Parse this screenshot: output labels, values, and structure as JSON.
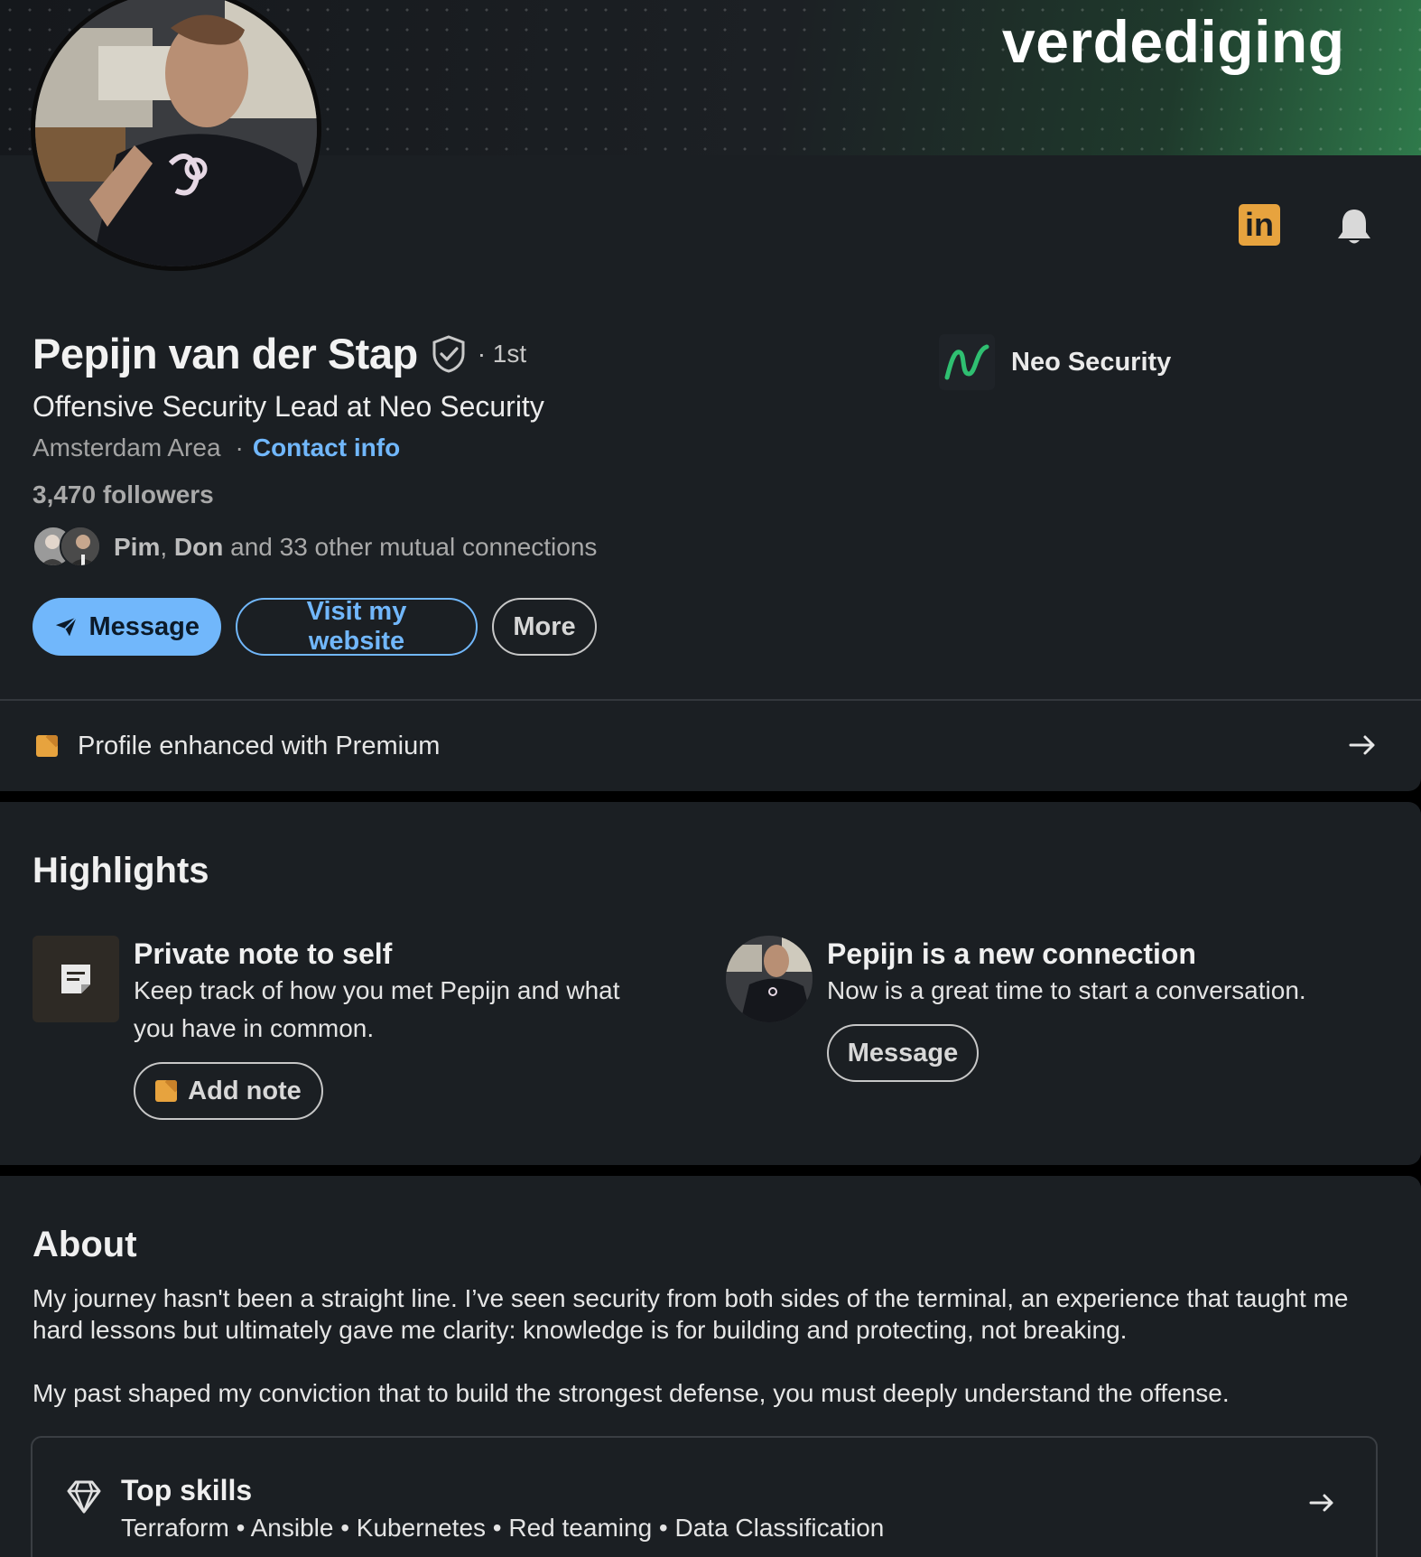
{
  "banner": {
    "word": "verdediging"
  },
  "profile": {
    "name": "Pepijn van der Stap",
    "degree": "· 1st",
    "headline": "Offensive Security Lead at Neo Security",
    "location": "Amsterdam Area",
    "location_separator": "·",
    "contact_label": "Contact info",
    "followers": "3,470 followers",
    "mutual": {
      "name1": "Pim",
      "sep": ", ",
      "name2": "Don",
      "rest": " and 33 other mutual connections"
    },
    "company": "Neo Security",
    "linkedin_badge": "in"
  },
  "actions": {
    "message": "Message",
    "website": "Visit my website",
    "more": "More"
  },
  "premium": {
    "label": "Profile enhanced with Premium"
  },
  "highlights": {
    "title": "Highlights",
    "note": {
      "title": "Private note to self",
      "line1": "Keep track of how you met Pepijn and what",
      "line2": "you have in common.",
      "button": "Add note"
    },
    "connection": {
      "title": "Pepijn is a new connection",
      "text": "Now is a great time to start a conversation.",
      "button": "Message"
    }
  },
  "about": {
    "title": "About",
    "paragraph1": "My journey hasn't been a straight line. I’ve seen security from both sides of the terminal, an experience that taught me hard lessons but ultimately gave me clarity: knowledge is for building and protecting, not breaking.",
    "paragraph2": "My past shaped my conviction that to build the strongest defense, you must deeply understand the offense."
  },
  "skills": {
    "title": "Top skills",
    "list": "Terraform • Ansible • Kubernetes • Red teaming • Data Classification"
  },
  "colors": {
    "accent_blue": "#71b7fb",
    "premium_gold": "#e7a33e",
    "card_bg": "#1b1f23",
    "brand_green": "#2fbf71"
  },
  "icons": [
    "linkedin-icon",
    "bell-icon",
    "verified-shield-icon",
    "send-icon",
    "premium-icon",
    "arrow-right-icon",
    "note-icon",
    "diamond-icon"
  ]
}
